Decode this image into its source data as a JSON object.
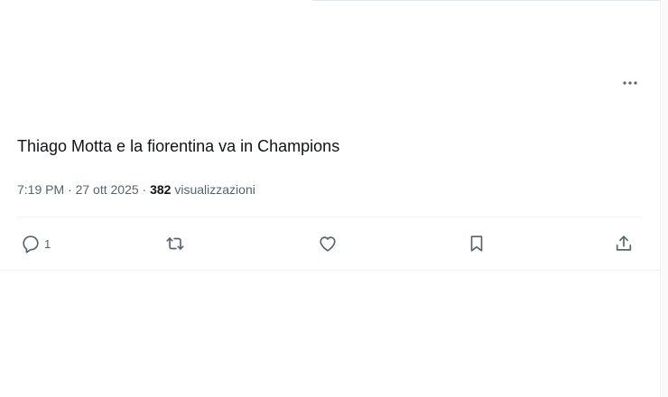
{
  "tweet": {
    "text": "Thiago Motta e la fiorentina va in Champions",
    "time": "7:19 PM",
    "date": "27 ott 2025",
    "separator": "·",
    "views_count": "382",
    "views_label": "visualizzazioni"
  },
  "actions": {
    "reply_count": "1",
    "icons": [
      "reply-icon",
      "retweet-icon",
      "like-icon",
      "bookmark-icon",
      "share-icon"
    ]
  },
  "colors": {
    "text": "#0f1419",
    "secondary": "#536471",
    "border": "#eff3f4"
  }
}
